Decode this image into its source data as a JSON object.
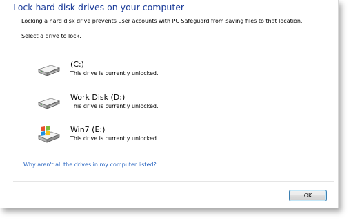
{
  "dialog": {
    "title": "Lock hard disk drives on your computer",
    "description": "Locking a hard disk drive prevents user accounts with PC Safeguard from saving files to that location.",
    "prompt": "Select a drive to lock."
  },
  "drives": [
    {
      "name": "(C:)",
      "status": "This drive is currently unlocked.",
      "icon": "hard-drive-icon"
    },
    {
      "name": "Work Disk (D:)",
      "status": "This drive is currently unlocked.",
      "icon": "hard-drive-icon"
    },
    {
      "name": "Win7 (E:)",
      "status": "This drive is currently unlocked.",
      "icon": "windows-drive-icon"
    }
  ],
  "help_link": "Why aren't all the drives in my computer listed?",
  "footer": {
    "ok_label": "OK"
  },
  "colors": {
    "title": "#1e3e9a",
    "link": "#1f5fbf",
    "button_border": "#3c7fb1"
  }
}
